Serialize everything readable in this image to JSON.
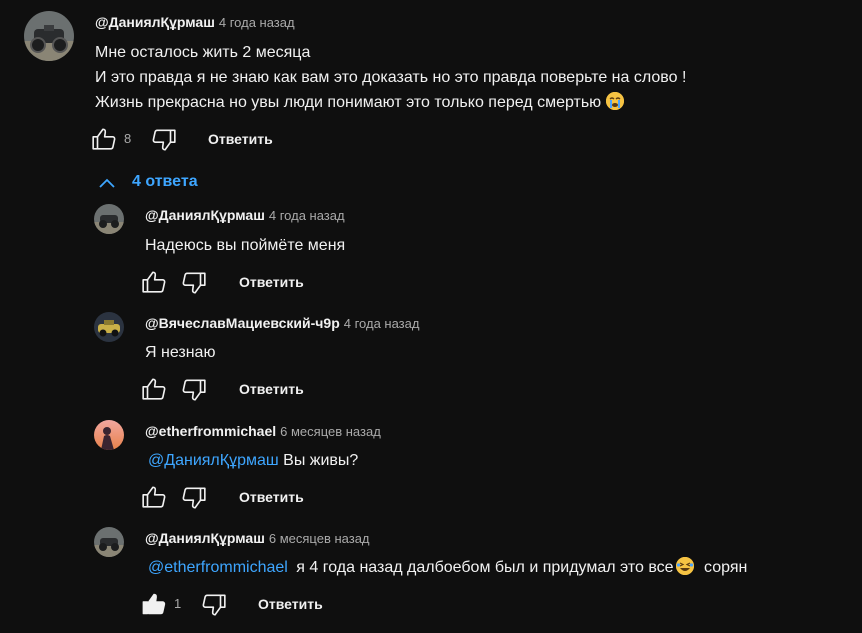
{
  "comment": {
    "author": "@ДаниялҚұрмаш",
    "time": "4 года назад",
    "lines": [
      "Мне осталось жить 2 месяца",
      "И это правда я не знаю как вам это доказать но это правда поверьте на слово !",
      "Жизнь прекрасна но увы люди понимают это только перед смертью"
    ],
    "likes": "8",
    "reply_label": "Ответить",
    "emoji": "crying-face-icon"
  },
  "replies_toggle": {
    "label": "4 ответа",
    "icon": "chevron-up-icon"
  },
  "replies": [
    {
      "author": "@ДаниялҚұрмаш",
      "time": "4 года назад",
      "text": "Надеюсь вы поймёте меня",
      "reply_label": "Ответить"
    },
    {
      "author": "@ВячеславМациевский-ч9р",
      "time": "4 года назад",
      "text": "Я незнаю",
      "reply_label": "Ответить"
    },
    {
      "author": "@etherfrommichael",
      "time": "6 месяцев назад",
      "mention": "@ДаниялҚұрмаш",
      "text": "Вы живы?",
      "reply_label": "Ответить"
    },
    {
      "author": "@ДаниялҚұрмаш",
      "time": "6 месяцев назад",
      "mention": "@etherfrommichael",
      "text_before_emoji": "я 4 года назад далбоебом был и придумал это все",
      "text_after_emoji": "сорян",
      "emoji": "laughing-face-icon",
      "likes": "1",
      "liked": true,
      "reply_label": "Ответить"
    }
  ],
  "colors": {
    "background": "#0f0f0f",
    "text": "#f1f1f1",
    "secondary": "#aaaaaa",
    "link": "#3ea6ff"
  }
}
